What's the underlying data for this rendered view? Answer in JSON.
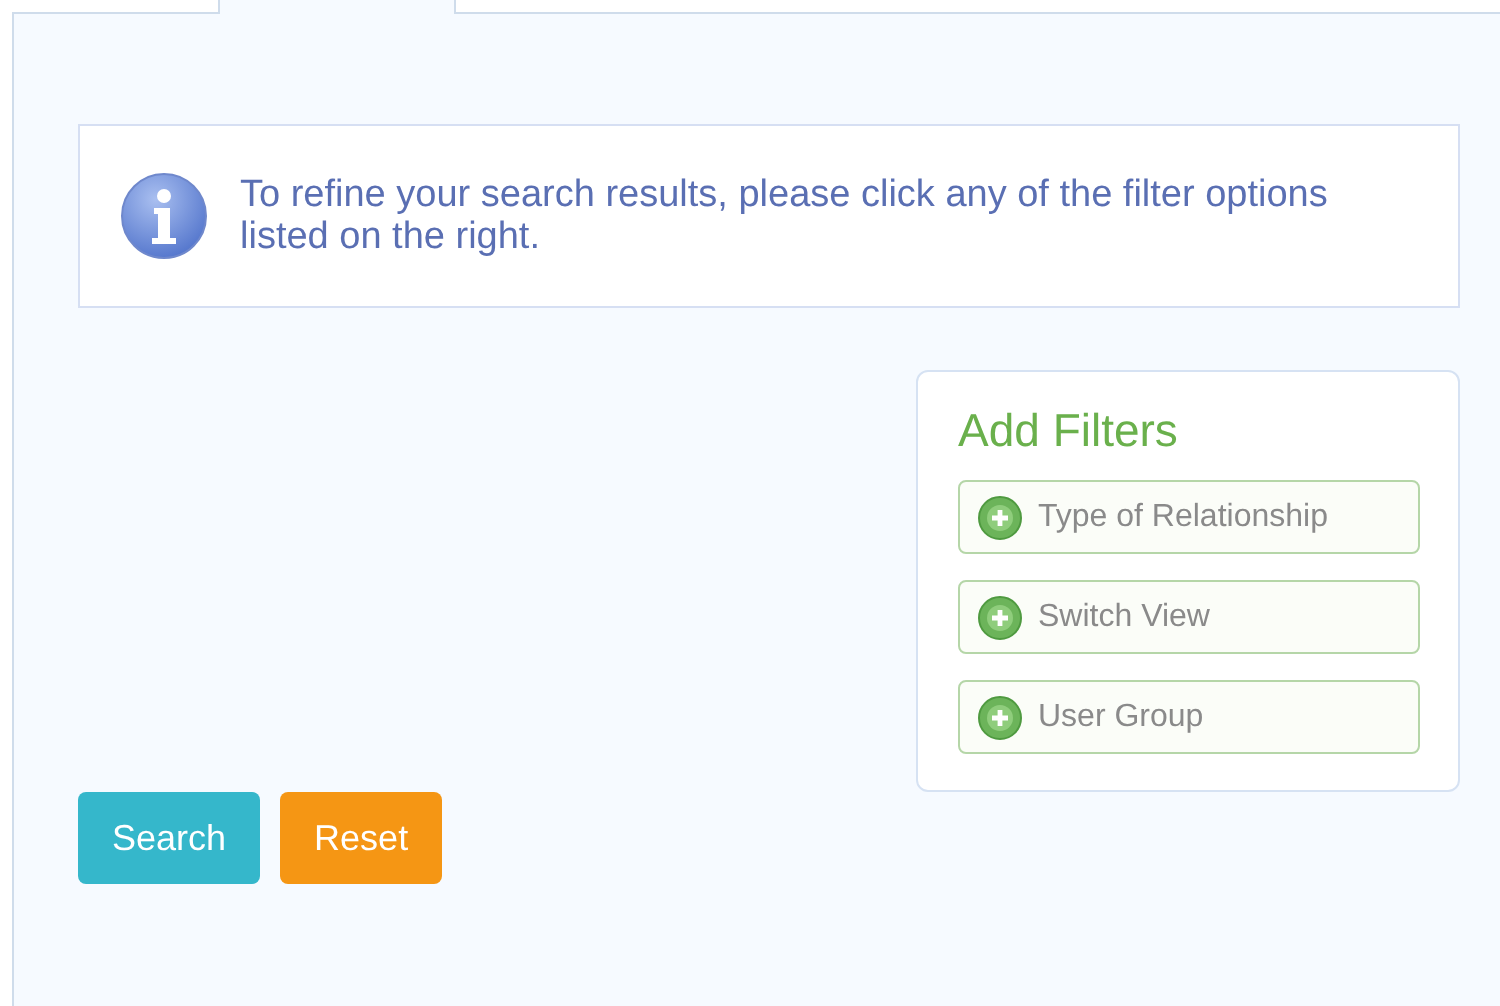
{
  "notice": {
    "text": "To refine your search results, please click any of the filter options listed on the right."
  },
  "filters": {
    "title": "Add Filters",
    "items": [
      {
        "label": "Type of Relationship"
      },
      {
        "label": "Switch View"
      },
      {
        "label": "User Group"
      }
    ]
  },
  "buttons": [
    {
      "label": "Search",
      "kind": "primary"
    },
    {
      "label": "Reset",
      "kind": "warning"
    }
  ]
}
